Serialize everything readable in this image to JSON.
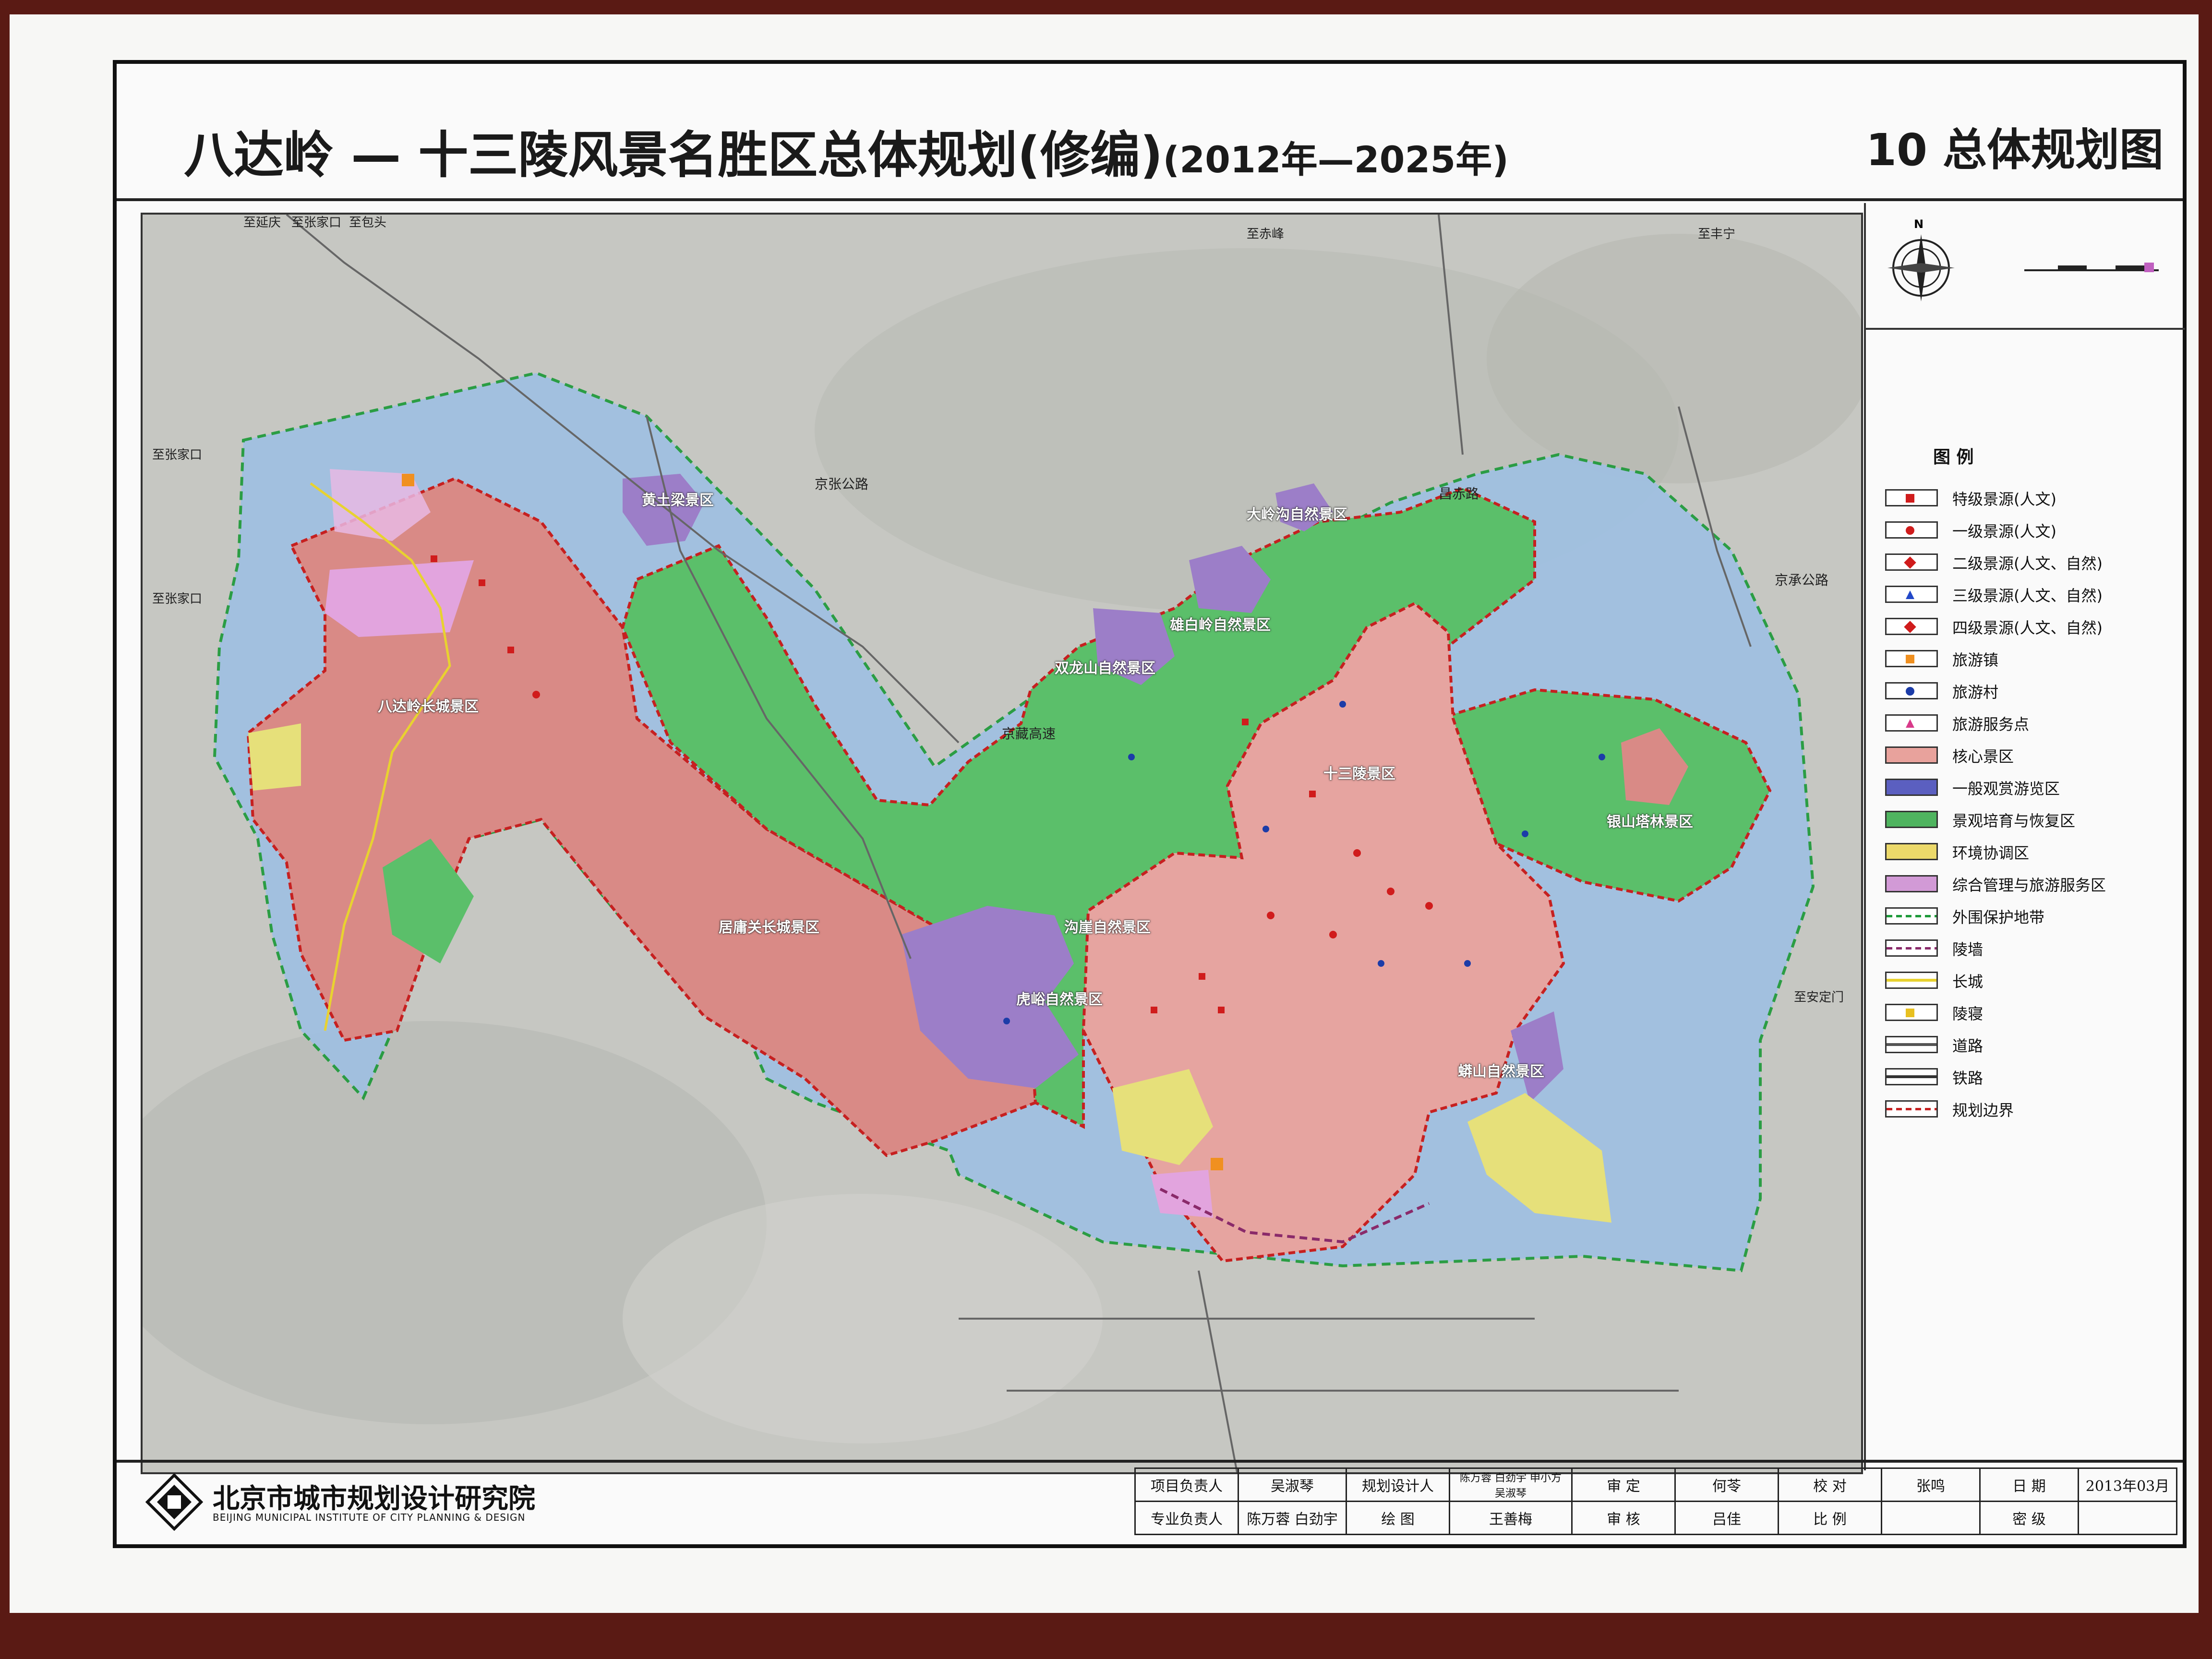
{
  "header": {
    "title_main": "八达岭 — 十三陵风景名胜区总体规划(修编)",
    "title_period": "(2012年—2025年)",
    "sheet_title": "10 总体规划图"
  },
  "map": {
    "directions": [
      "至延庆",
      "至张家口",
      "至包头",
      "至赤峰",
      "至丰宁",
      "至张家口",
      "至张家口",
      "至安定门"
    ],
    "roads": [
      "京张公路",
      "京藏高速",
      "昌赤路",
      "京承公路"
    ],
    "zones": [
      "八达岭长城景区",
      "黄土梁景区",
      "大岭沟自然景区",
      "雄白岭自然景区",
      "双龙山自然景区",
      "十三陵景区",
      "银山塔林景区",
      "沟崖自然景区",
      "居庸关长城景区",
      "虎峪自然景区",
      "蟒山自然景区"
    ],
    "colors": {
      "core": "#d98c88",
      "general": "#9c7ec8",
      "restore": "#5bbf6a",
      "coordination": "#e6e07a",
      "service": "#e2a4de",
      "outer": "#9fbfe0",
      "boundary": "#c62020"
    }
  },
  "compass": {
    "north_label": "N"
  },
  "legend": {
    "title": "图 例",
    "items": [
      {
        "label": "特级景源(人文)",
        "icon": "red-square",
        "color": "#d01c1c"
      },
      {
        "label": "一级景源(人文)",
        "icon": "red-dot",
        "color": "#d01c1c"
      },
      {
        "label": "二级景源(人文、自然)",
        "icon": "diamond-pair",
        "color": "#d01c1c"
      },
      {
        "label": "三级景源(人文、自然)",
        "icon": "triangle-pair",
        "color": "#2248c8"
      },
      {
        "label": "四级景源(人文、自然)",
        "icon": "star-pair",
        "color": "#d01c1c"
      },
      {
        "label": "旅游镇",
        "icon": "orange-square",
        "color": "#f09020"
      },
      {
        "label": "旅游村",
        "icon": "blue-dot",
        "color": "#1c3ca8"
      },
      {
        "label": "旅游服务点",
        "icon": "pink-triangle",
        "color": "#d83a8a"
      },
      {
        "label": "核心景区",
        "icon": "fill",
        "color": "#e8a29c"
      },
      {
        "label": "一般观赏游览区",
        "icon": "fill",
        "color": "#5b5fc0"
      },
      {
        "label": "景观培育与恢复区",
        "icon": "fill",
        "color": "#4fb45f"
      },
      {
        "label": "环境协调区",
        "icon": "fill",
        "color": "#ecd96a"
      },
      {
        "label": "综合管理与旅游服务区",
        "icon": "fill",
        "color": "#d29ad6"
      },
      {
        "label": "外围保护地带",
        "icon": "green-dashed",
        "color": "#1e9a3a"
      },
      {
        "label": "陵墙",
        "icon": "purple-dashed",
        "color": "#8a2a6a"
      },
      {
        "label": "长城",
        "icon": "yellow-line",
        "color": "#e8d230"
      },
      {
        "label": "陵寝",
        "icon": "tomb",
        "color": "#e8c020"
      },
      {
        "label": "道路",
        "icon": "double-line",
        "color": "#555555"
      },
      {
        "label": "铁路",
        "icon": "rail",
        "color": "#333333"
      },
      {
        "label": "规划边界",
        "icon": "red-dashed",
        "color": "#c62020"
      }
    ]
  },
  "footer": {
    "institute_cn": "北京市城市规划设计研究院",
    "institute_en": "BEIJING MUNICIPAL INSTITUTE OF CITY PLANNING & DESIGN",
    "row1": [
      "项目负责人",
      "吴淑琴",
      "规划设计人",
      "陈万蓉 白劲宇 申小方 吴淑琴",
      "审 定",
      "何苓",
      "校 对",
      "张鸣",
      "日 期",
      "2013年03月"
    ],
    "row2": [
      "专业负责人",
      "陈万蓉 白劲宇",
      "绘 图",
      "王善梅",
      "审 核",
      "吕佳",
      "比 例",
      "",
      "密 级",
      ""
    ]
  }
}
